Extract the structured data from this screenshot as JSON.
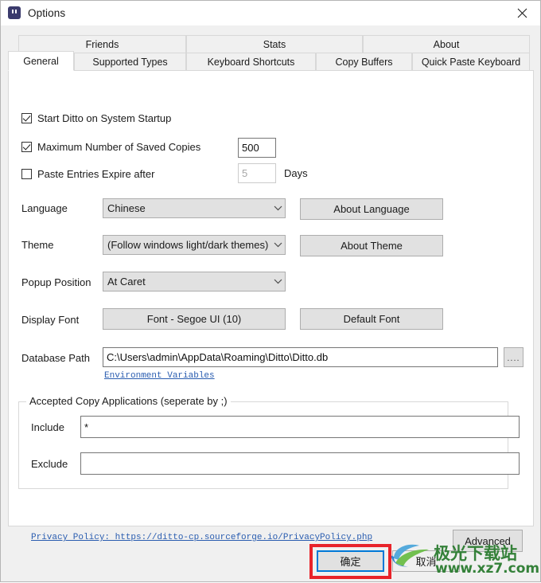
{
  "window": {
    "title": "Options",
    "icon": "ditto-quotes-icon",
    "close_label": "close-icon"
  },
  "tabs": {
    "row1": [
      {
        "label": "Friends"
      },
      {
        "label": "Stats"
      },
      {
        "label": "About"
      }
    ],
    "row2": [
      {
        "label": "General",
        "selected": true
      },
      {
        "label": "Supported Types"
      },
      {
        "label": "Keyboard Shortcuts"
      },
      {
        "label": "Copy Buffers"
      },
      {
        "label": "Quick Paste Keyboard"
      }
    ]
  },
  "general": {
    "startup_checkbox": {
      "label": "Start Ditto on System Startup",
      "checked": true
    },
    "max_copies_checkbox": {
      "label": "Maximum Number of Saved Copies",
      "checked": true
    },
    "max_copies_value": "500",
    "expire_checkbox": {
      "label": "Paste Entries Expire after",
      "checked": false
    },
    "expire_value": "5",
    "expire_units": "Days",
    "language_label": "Language",
    "language_value": "Chinese",
    "about_language_button": "About Language",
    "theme_label": "Theme",
    "theme_value": "(Follow windows light/dark themes)",
    "about_theme_button": "About Theme",
    "popup_position_label": "Popup Position",
    "popup_position_value": "At Caret",
    "display_font_label": "Display Font",
    "display_font_value": "Font - Segoe UI (10)",
    "default_font_button": "Default Font",
    "database_path_label": "Database Path",
    "database_path_value": "C:\\Users\\admin\\AppData\\Roaming\\Ditto\\Ditto.db",
    "browse_button": "....",
    "environment_variables_link": "Environment Variables",
    "accepted_group_caption": "Accepted Copy Applications (seperate by ;)",
    "include_label": "Include",
    "include_value": "*",
    "exclude_label": "Exclude",
    "exclude_value": "",
    "privacy_policy_link": "Privacy Policy: https://ditto-cp.sourceforge.io/PrivacyPolicy.php",
    "advanced_button": "Advanced"
  },
  "footer": {
    "ok_button": "确定",
    "cancel_button": "取消"
  },
  "watermark": {
    "site_name": "极光下载站",
    "url": "www.xz7.com"
  },
  "colors": {
    "accent_focus": "#0078d7",
    "highlight_red": "#e8232a",
    "link_blue": "#2a5db0",
    "watermark_green": "#2d7d32",
    "dialog_bg": "#f0f0f0",
    "page_bg": "#ffffff"
  }
}
